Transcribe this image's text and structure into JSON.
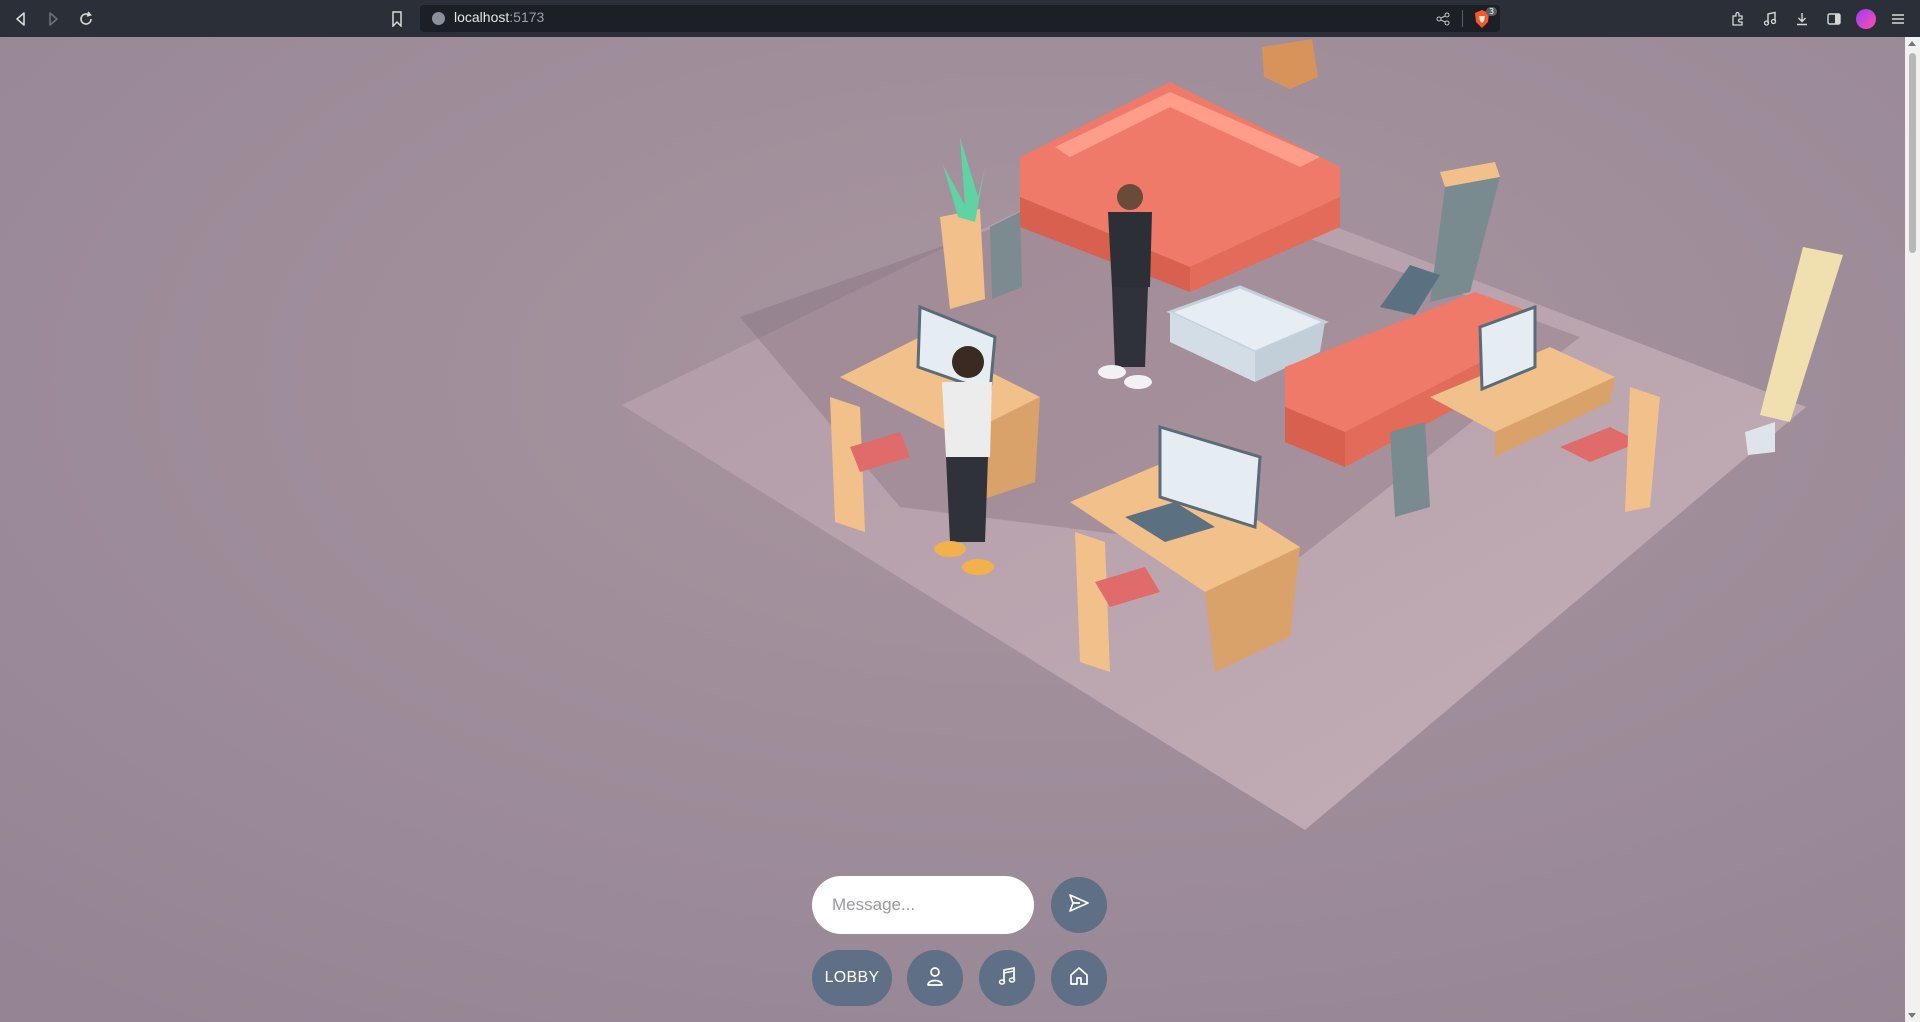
{
  "browser": {
    "url_host": "localhost",
    "url_port": ":5173",
    "shield_badge": "3"
  },
  "chat": {
    "message_placeholder": "Message..."
  },
  "toolbar": {
    "lobby_label": "LOBBY"
  },
  "colors": {
    "background": "#9e8f9c",
    "floor": "#b9a4ae",
    "button": "#5e6f86",
    "sofa": "#f07a6a",
    "desk": "#f2c08a",
    "chair_seat": "#e06b6b"
  },
  "icons": {
    "back": "back-icon",
    "forward": "forward-icon",
    "reload": "reload-icon",
    "bookmark": "bookmark-icon",
    "send": "send-icon",
    "avatar": "person-icon",
    "music": "music-note-icon",
    "home": "home-icon"
  }
}
